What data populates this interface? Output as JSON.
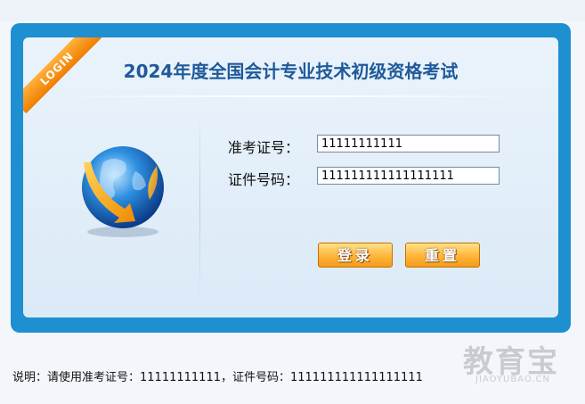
{
  "login_badge": "LOGIN",
  "title": "2024年度全国会计专业技术初级资格考试",
  "form": {
    "exam_id_label": "准考证号：",
    "exam_id_value": "11111111111",
    "id_number_label": "证件号码：",
    "id_number_value": "111111111111111111"
  },
  "buttons": {
    "login": "登录",
    "reset": "重置"
  },
  "note": "说明：请使用准考证号：11111111111，证件号码：111111111111111111",
  "watermark": {
    "text": "教育宝",
    "sub": "JIAOYUBAO.CN"
  },
  "colors": {
    "frame": "#1e8fd0",
    "title": "#1f5a9a",
    "button": "#f39c1b",
    "badge": "#f07e00"
  },
  "icons": [
    "globe-icon"
  ]
}
